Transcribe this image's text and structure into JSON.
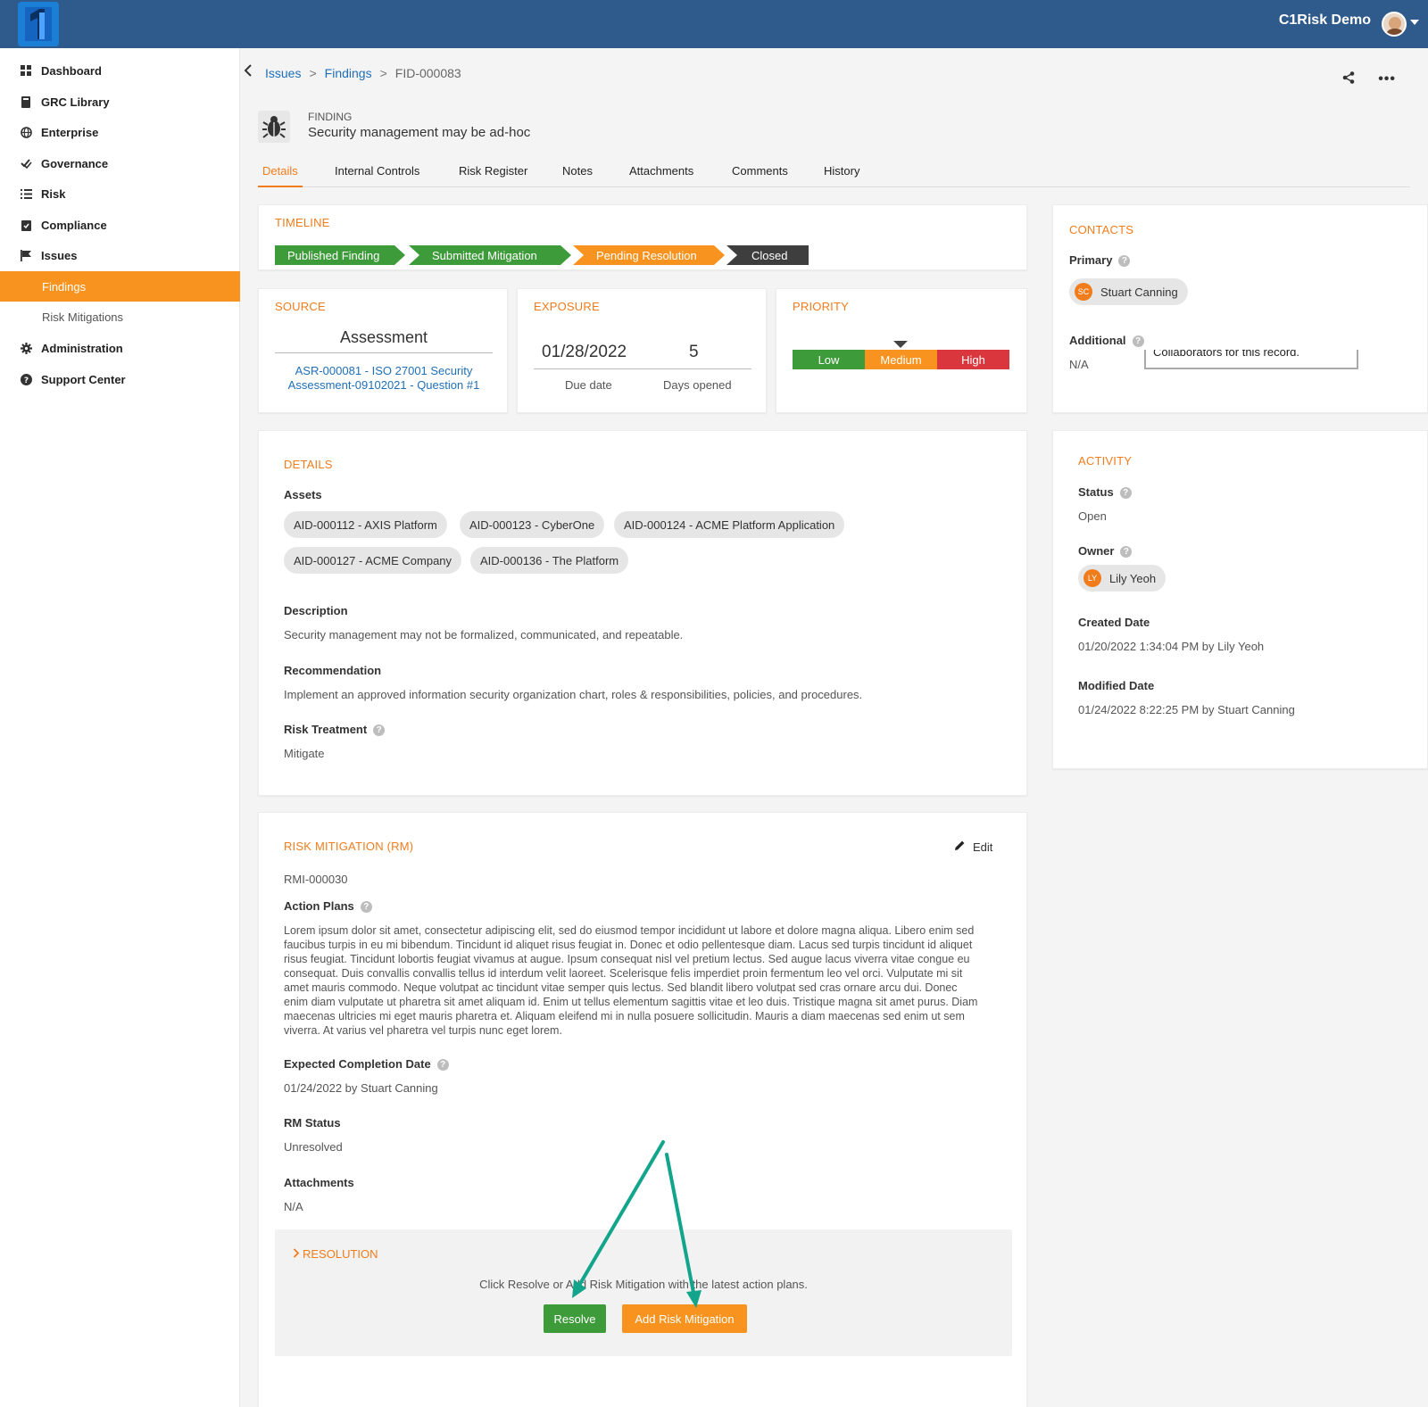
{
  "header": {
    "user_name": "C1Risk Demo"
  },
  "sidebar": {
    "items": [
      {
        "label": "Dashboard",
        "icon": "dashboard-icon"
      },
      {
        "label": "GRC Library",
        "icon": "book-icon"
      },
      {
        "label": "Enterprise",
        "icon": "globe-icon"
      },
      {
        "label": "Governance",
        "icon": "check-double-icon"
      },
      {
        "label": "Risk",
        "icon": "list-icon"
      },
      {
        "label": "Compliance",
        "icon": "clipboard-check-icon"
      },
      {
        "label": "Issues",
        "icon": "flag-icon"
      },
      {
        "label": "Findings",
        "active": true
      },
      {
        "label": "Risk Mitigations"
      },
      {
        "label": "Administration",
        "icon": "gear-icon"
      },
      {
        "label": "Support Center",
        "icon": "question-circle-icon"
      }
    ]
  },
  "breadcrumb": {
    "items": [
      "Issues",
      "Findings"
    ],
    "current": "FID-000083"
  },
  "finding": {
    "type": "FINDING",
    "title": "Security management may be ad-hoc"
  },
  "tabs": [
    "Details",
    "Internal Controls",
    "Risk Register",
    "Notes",
    "Attachments",
    "Comments",
    "History"
  ],
  "timeline": {
    "title": "TIMELINE",
    "steps": [
      "Published Finding",
      "Submitted Mitigation",
      "Pending Resolution",
      "Closed"
    ],
    "current_step": "Pending Resolution"
  },
  "source": {
    "title": "SOURCE",
    "value": "Assessment",
    "link_line1": "ASR-000081 - ISO 27001 Security",
    "link_line2": "Assessment-09102021 - Question #1"
  },
  "exposure": {
    "title": "EXPOSURE",
    "due_date": "01/28/2022",
    "days_opened": "5",
    "due_label": "Due date",
    "days_label": "Days opened"
  },
  "priority": {
    "title": "PRIORITY",
    "levels": [
      "Low",
      "Medium",
      "High"
    ],
    "selected": "Medium",
    "colors": {
      "low": "#3e9b3a",
      "medium": "#f7931e",
      "high": "#d9363e"
    }
  },
  "contacts": {
    "title": "CONTACTS",
    "primary_label": "Primary",
    "primary_initials": "SC",
    "primary_name": "Stuart Canning",
    "additional_label": "Additional",
    "additional_value": "N/A",
    "tooltip": "Collaborators for this record."
  },
  "details": {
    "title": "DETAILS",
    "assets_label": "Assets",
    "assets": [
      "AID-000112 - AXIS Platform",
      "AID-000123 - CyberOne",
      "AID-000124 - ACME Platform Application",
      "AID-000127 - ACME Company",
      "AID-000136 - The Platform"
    ],
    "description_label": "Description",
    "description": "Security management may not be formalized, communicated, and repeatable.",
    "recommendation_label": "Recommendation",
    "recommendation": "Implement an approved information security organization chart, roles & responsibilities, policies, and procedures.",
    "treatment_label": "Risk Treatment",
    "treatment": "Mitigate"
  },
  "activity": {
    "title": "ACTIVITY",
    "status_label": "Status",
    "status": "Open",
    "owner_label": "Owner",
    "owner_initials": "LY",
    "owner_name": "Lily Yeoh",
    "created_label": "Created Date",
    "created": "01/20/2022 1:34:04 PM by Lily Yeoh",
    "modified_label": "Modified Date",
    "modified": "01/24/2022 8:22:25 PM by Stuart Canning"
  },
  "mitigation": {
    "title": "RISK MITIGATION (RM)",
    "edit_label": "Edit",
    "id": "RMI-000030",
    "action_plans_label": "Action Plans",
    "action_plans_lines": [
      "Lorem ipsum dolor sit amet, consectetur adipiscing elit, sed do eiusmod tempor incididunt ut labore et dolore magna aliqua. Libero enim sed",
      "faucibus turpis in eu mi bibendum. Tincidunt id aliquet risus feugiat in. Donec et odio pellentesque diam. Lacus sed turpis tincidunt id aliquet",
      "risus feugiat. Tincidunt lobortis feugiat vivamus at augue. Ipsum consequat nisl vel pretium lectus. Sed augue lacus viverra vitae congue eu",
      "consequat. Duis convallis convallis tellus id interdum velit laoreet. Scelerisque felis imperdiet proin fermentum leo vel orci. Vulputate mi sit",
      "amet mauris commodo. Neque volutpat ac tincidunt vitae semper quis lectus. Sed blandit libero volutpat sed cras ornare arcu dui. Donec",
      "enim diam vulputate ut pharetra sit amet aliquam id. Enim ut tellus elementum sagittis vitae et leo duis. Tristique magna sit amet purus. Diam",
      "maecenas ultricies mi eget mauris pharetra et. Aliquam eleifend mi in nulla posuere sollicitudin. Mauris a diam maecenas sed enim ut sem",
      "viverra. At varius vel pharetra vel turpis nunc eget lorem."
    ],
    "completion_label": "Expected Completion Date",
    "completion": "01/24/2022 by Stuart Canning",
    "rm_status_label": "RM Status",
    "rm_status": "Unresolved",
    "attachments_label": "Attachments",
    "attachments": "N/A"
  },
  "resolution": {
    "title": "RESOLUTION",
    "hint": "Click Resolve or Add Risk Mitigation with the latest action plans.",
    "resolve_label": "Resolve",
    "add_label": "Add Risk Mitigation",
    "annotation_arrow_color": "#12a58b"
  },
  "colors": {
    "brand_bar": "#2f5b8c",
    "accent": "#f07c1c",
    "link": "#1f6fb8",
    "success": "#3e9b3a"
  }
}
